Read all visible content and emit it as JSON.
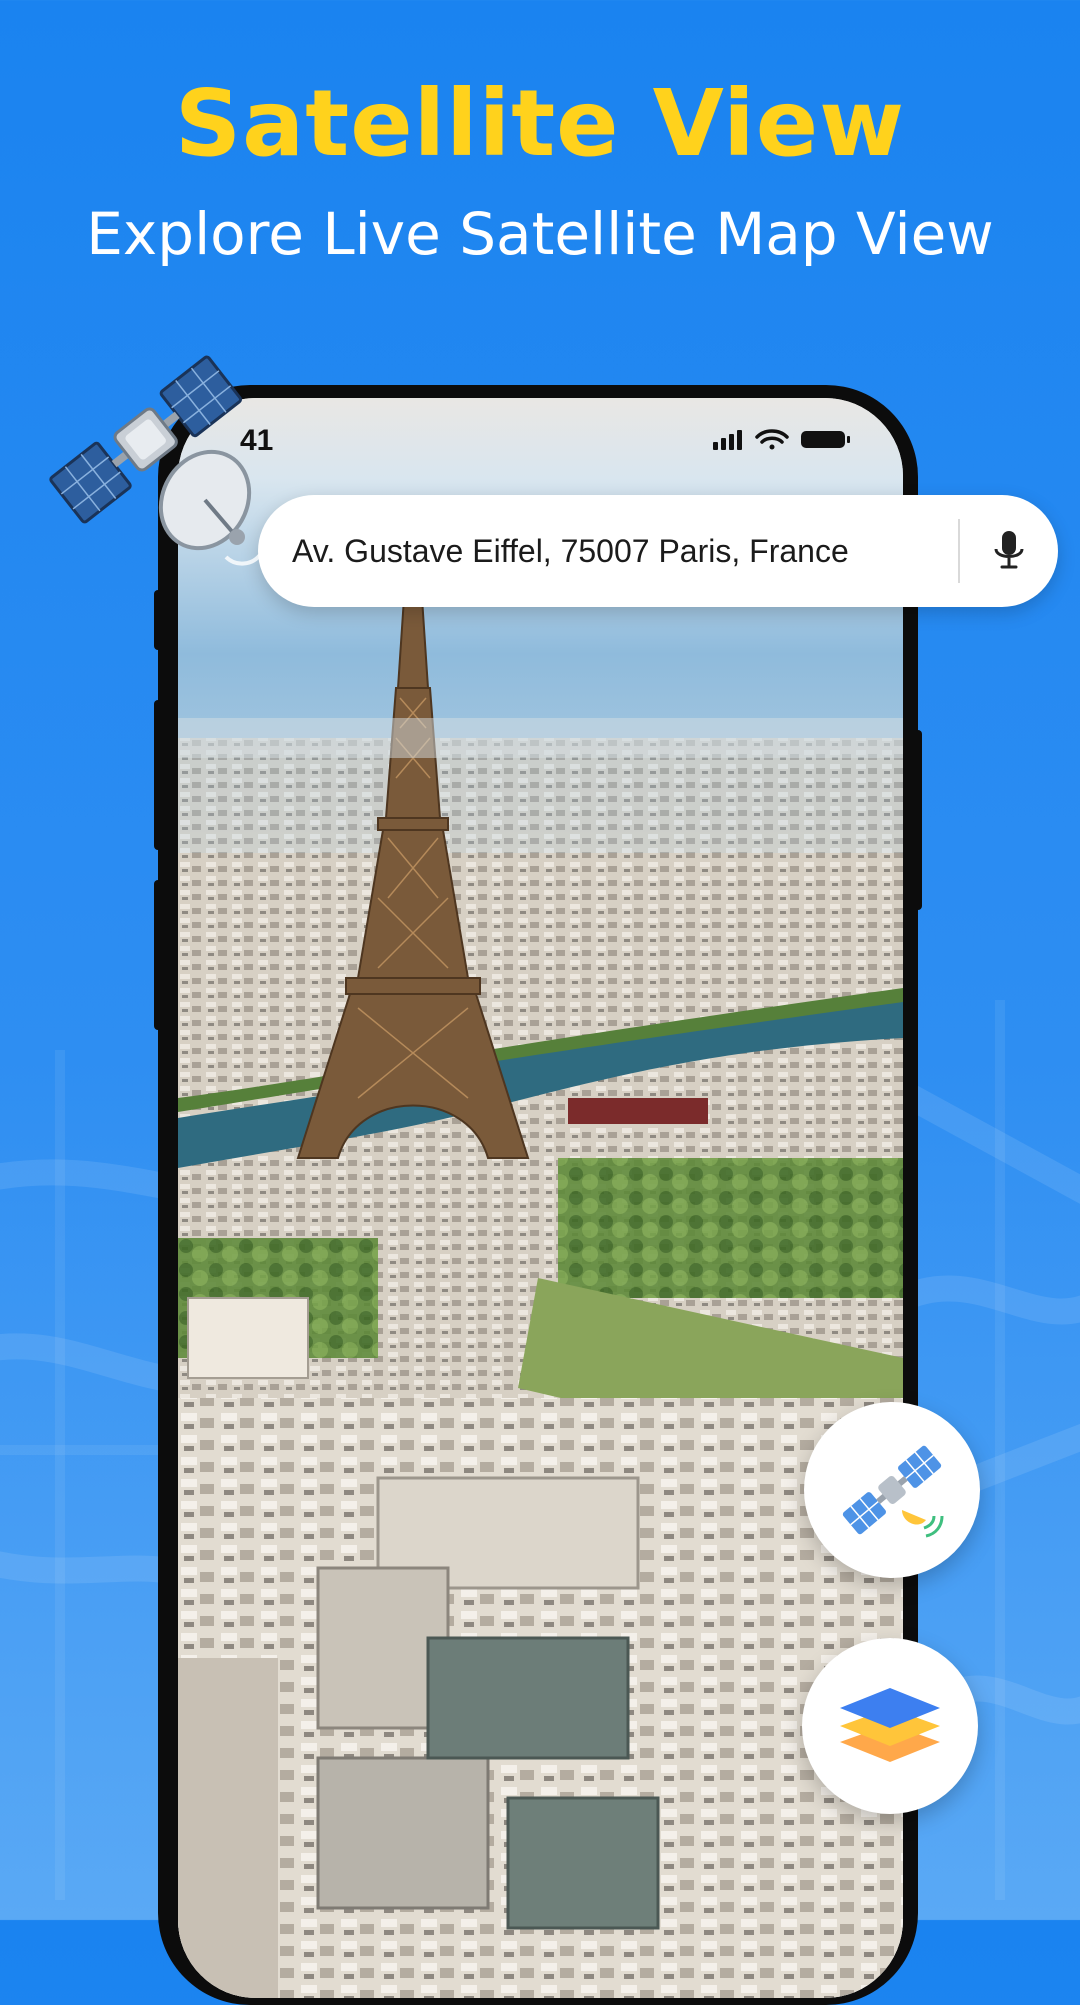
{
  "header": {
    "title": "Satellite View",
    "subtitle": "Explore Live Satellite Map View"
  },
  "status_bar": {
    "time": "41",
    "icons": [
      "signal-icon",
      "wifi-icon",
      "battery-icon"
    ]
  },
  "search": {
    "value": "Av. Gustave Eiffel, 75007 Paris, France",
    "mic_icon": "microphone-icon"
  },
  "buttons": {
    "satellite_icon": "satellite-icon",
    "layers_icon": "layers-icon"
  },
  "colors": {
    "background": "#1a83f0",
    "title": "#ffd21c",
    "subtitle": "#ffffff",
    "layers_blue": "#3d7ff0",
    "layers_yellow": "#ffc53a",
    "layers_orange": "#ffa84a"
  }
}
